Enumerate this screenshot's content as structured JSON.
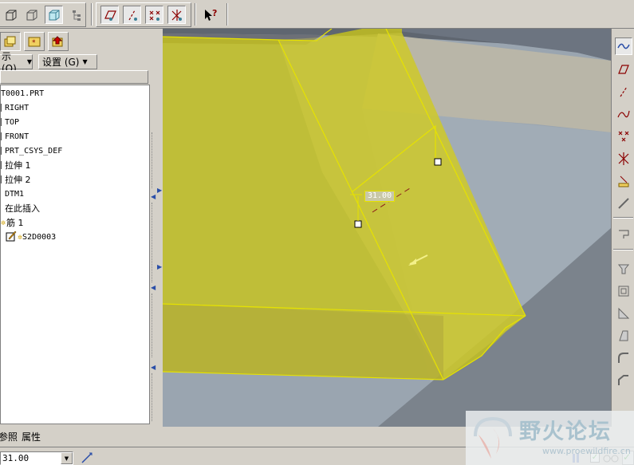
{
  "toolbar": {
    "icons": [
      "wireframe-icon",
      "hidden-line-icon",
      "shaded-icon",
      "model-tree-toggle-icon",
      "datum-plane-toggle-icon",
      "datum-axis-toggle-icon",
      "datum-point-toggle-icon",
      "csys-toggle-icon",
      "context-help-icon"
    ]
  },
  "left_panel": {
    "menu_show_label": "示 (Q)",
    "menu_settings_label": "设置 (G)",
    "tree": [
      {
        "label": "T0001.PRT",
        "kind": "part"
      },
      {
        "label": "RIGHT",
        "kind": "plane"
      },
      {
        "label": "TOP",
        "kind": "plane"
      },
      {
        "label": "FRONT",
        "kind": "plane"
      },
      {
        "label": "PRT_CSYS_DEF",
        "kind": "csys"
      },
      {
        "label": "拉伸 1",
        "kind": "extrude"
      },
      {
        "label": "拉伸 2",
        "kind": "extrude"
      },
      {
        "label": "DTM1",
        "kind": "plane"
      },
      {
        "label": "在此插入",
        "kind": "insert"
      },
      {
        "label": "筋 1",
        "kind": "rib"
      },
      {
        "label": "S2D0003",
        "kind": "sketch"
      }
    ]
  },
  "viewport": {
    "dimension_label": "31.00"
  },
  "bottom": {
    "tab_refs": "参照",
    "tab_props": "属性",
    "dimension_value": "31.00"
  },
  "watermark": {
    "title": "野火论坛",
    "url": "www.proewildfire.cn"
  },
  "colors": {
    "rib_fill": "#c8c41a",
    "edge": "#e6e200",
    "background": "#9aa5b0",
    "panel": "#d4d0c8"
  }
}
